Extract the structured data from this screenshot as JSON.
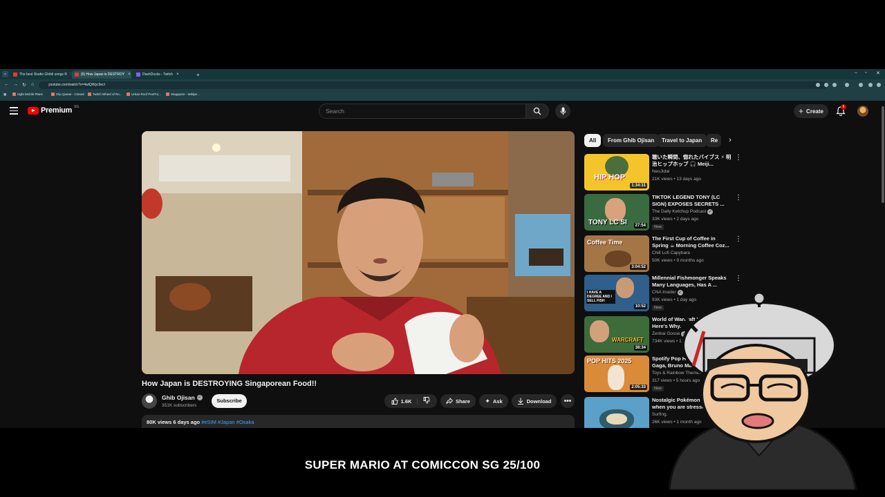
{
  "browser": {
    "tabs": [
      {
        "title": "The best Studio Ghibli songs R"
      },
      {
        "title": "(6) How Japan is DESTROY"
      },
      {
        "title": "DashDocks - Twitch"
      }
    ],
    "url": "youtube.com/watch?v=4wtQWyc9ecI",
    "bookmarks": [
      "night Mobile Plans",
      "Clip Queue - Closed",
      "Twitch Wheel of Ro...",
      "Urban Roof PenPro...",
      "Singapore - Wikipe..."
    ]
  },
  "youtube": {
    "logo_text": "Premium",
    "region": "SG",
    "search_placeholder": "Search",
    "create_label": "Create",
    "notification_count": "6"
  },
  "video": {
    "title": "How Japan is DESTROYING Singaporean Food!!",
    "channel": "Ghib Ojisan",
    "subscribers": "351K subscribers",
    "subscribe_label": "Subscribe",
    "likes": "1.6K",
    "share_label": "Share",
    "ask_label": "Ask",
    "download_label": "Download",
    "views_date": "80K views  6 days ago",
    "tags": "#eSIM #Japan #Osaka"
  },
  "chips": [
    "All",
    "From Ghib Ojisan",
    "Travel to Japan",
    "Re"
  ],
  "recommendations": [
    {
      "title": "聴いた瞬間、惚れたバイブス ⚡ 明治ヒップホップ 🎧 Meiji...",
      "channel": "NeoJidai",
      "meta": "21K views • 13 days ago",
      "duration": "1:34:31",
      "thumb_text": "HIP HOP",
      "badge": ""
    },
    {
      "title": "TIKTOK LEGEND TONY (LC SIGN) EXPOSES SECRETS ...",
      "channel": "The Daily Ketchup Podcast",
      "meta": "33K views • 2 days ago",
      "duration": "27:54",
      "thumb_text": "TONY LC SI",
      "badge": "New"
    },
    {
      "title": "The First Cup of Coffee in Spring ☕ Morning Coffee Coz...",
      "channel": "Chill Lofi Capybara",
      "meta": "50K views • 9 months ago",
      "duration": "3:04:52",
      "thumb_text": "Coffee Time",
      "badge": ""
    },
    {
      "title": "Millennial Fishmonger Speaks Many Languages, Has A ...",
      "channel": "CNA Insider",
      "meta": "93K views • 1 day ago",
      "duration": "10:52",
      "thumb_text": "I HAVE A DEGREE AND I SELL FISH",
      "badge": "New"
    },
    {
      "title": "World of Warcraft Will End. Here's Why.",
      "channel": "Zenkai Goose",
      "meta": "734K views • 1 year ago",
      "duration": "38:34",
      "thumb_text": "WARCRAFT",
      "badge": ""
    },
    {
      "title": "Spotify Pop Hits 2025 ♫ Lady Gaga, Bruno Mars, Ed Sheeran...",
      "channel": "Toys & Rainbow Themes",
      "meta": "317 views • 5 hours ago",
      "duration": "2:05:33",
      "thumb_text": "POP HITS 2025",
      "badge": "New"
    },
    {
      "title": "Nostalgic Pokémon Jazz for when you are stressed",
      "channel": "Surfing.",
      "meta": "26K views • 1 month ago",
      "duration": "",
      "thumb_text": "",
      "badge": ""
    }
  ],
  "caption": "SUPER MARIO AT COMICCON SG 25/100",
  "colors": {
    "brand_red": "#ff0000",
    "page_bg": "#0f0f0f",
    "chrome_bg": "#1f3f45",
    "link_blue": "#3ea6ff"
  }
}
